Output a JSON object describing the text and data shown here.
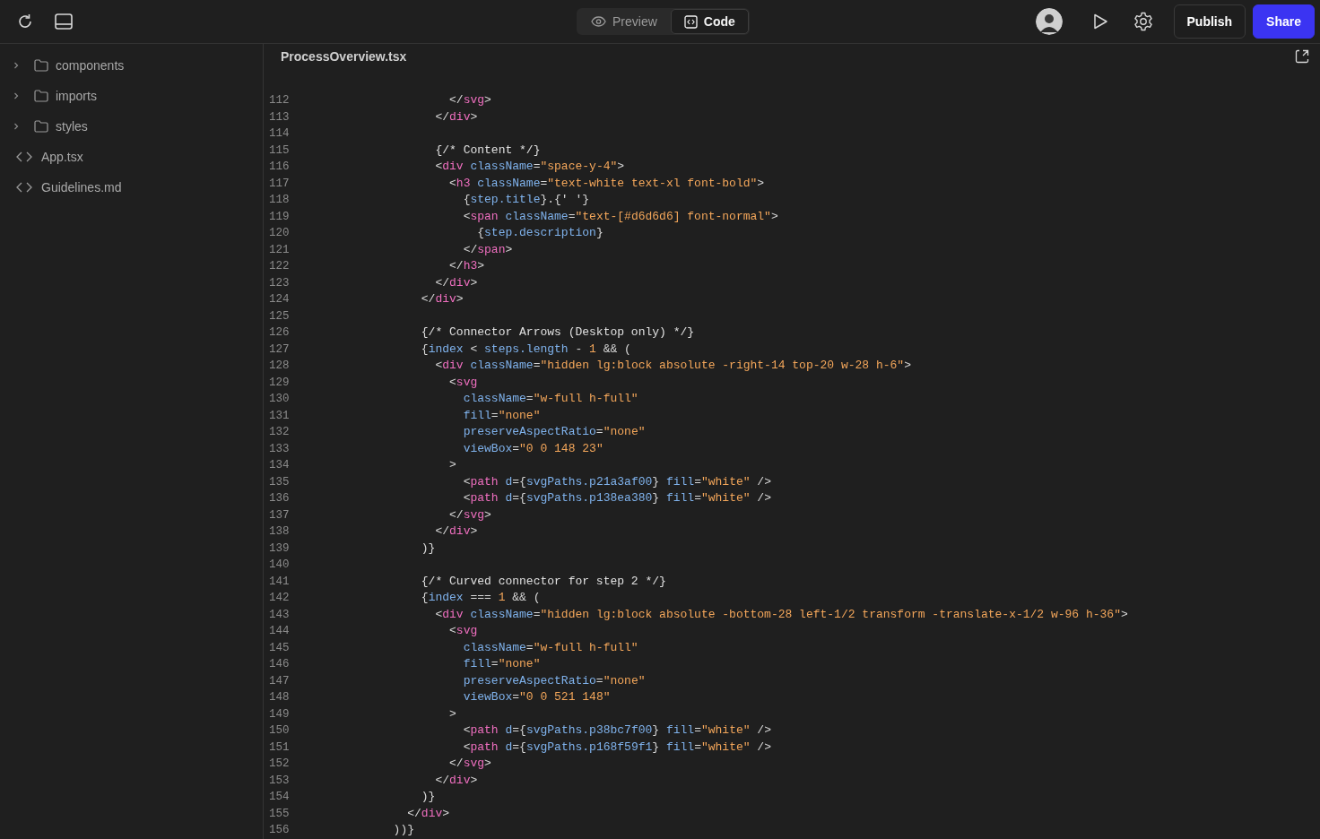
{
  "toolbar": {
    "view_tabs": [
      {
        "label": "Preview",
        "kind": "preview",
        "selected": false
      },
      {
        "label": "Code",
        "kind": "code",
        "selected": true
      }
    ],
    "buttons": [
      {
        "label": "Publish",
        "kind": "secondary"
      },
      {
        "label": "Share",
        "kind": "primary"
      }
    ]
  },
  "sidebar": {
    "items": [
      {
        "label": "components",
        "kind": "folder",
        "expanded": false
      },
      {
        "label": "imports",
        "kind": "folder",
        "expanded": false
      },
      {
        "label": "styles",
        "kind": "folder",
        "expanded": false
      },
      {
        "label": "App.tsx",
        "kind": "file"
      },
      {
        "label": "Guidelines.md",
        "kind": "file"
      }
    ]
  },
  "editor": {
    "file_tab": "ProcessOverview.tsx",
    "lines": [
      {
        "n": "112",
        "code": [
          {
            "text": "                    </",
            "kind": "punct"
          },
          {
            "text": "svg",
            "kind": "tag"
          },
          {
            "text": ">",
            "kind": "punct"
          }
        ]
      },
      {
        "n": "113",
        "code": [
          {
            "text": "                  </",
            "kind": "punct"
          },
          {
            "text": "div",
            "kind": "tag"
          },
          {
            "text": ">",
            "kind": "punct"
          }
        ]
      },
      {
        "n": "114"
      },
      {
        "n": "115",
        "code": [
          {
            "text": "                  {/* Content */}",
            "kind": "comment"
          }
        ]
      },
      {
        "n": "116",
        "code": [
          {
            "text": "                  <",
            "kind": "punct"
          },
          {
            "text": "div",
            "kind": "tag"
          },
          {
            "text": " className",
            "kind": "attr"
          },
          {
            "text": "=",
            "kind": "punct"
          },
          {
            "text": "\"space-y-4\"",
            "kind": "string"
          },
          {
            "text": ">",
            "kind": "punct"
          }
        ]
      },
      {
        "n": "117",
        "code": [
          {
            "text": "                    <",
            "kind": "punct"
          },
          {
            "text": "h3",
            "kind": "tag"
          },
          {
            "text": " className",
            "kind": "attr"
          },
          {
            "text": "=",
            "kind": "punct"
          },
          {
            "text": "\"text-white text-xl font-bold\"",
            "kind": "string"
          },
          {
            "text": ">",
            "kind": "punct"
          }
        ]
      },
      {
        "n": "118",
        "code": [
          {
            "text": "                      {",
            "kind": "punct"
          },
          {
            "text": "step.title",
            "kind": "variable"
          },
          {
            "text": "}.{' '}",
            "kind": "punct"
          }
        ]
      },
      {
        "n": "119",
        "code": [
          {
            "text": "                      <",
            "kind": "punct"
          },
          {
            "text": "span",
            "kind": "tag"
          },
          {
            "text": " className",
            "kind": "attr"
          },
          {
            "text": "=",
            "kind": "punct"
          },
          {
            "text": "\"text-[#d6d6d6] font-normal\"",
            "kind": "string"
          },
          {
            "text": ">",
            "kind": "punct"
          }
        ]
      },
      {
        "n": "120",
        "code": [
          {
            "text": "                        {",
            "kind": "punct"
          },
          {
            "text": "step.description",
            "kind": "variable"
          },
          {
            "text": "}",
            "kind": "punct"
          }
        ]
      },
      {
        "n": "121",
        "code": [
          {
            "text": "                      </",
            "kind": "punct"
          },
          {
            "text": "span",
            "kind": "tag"
          },
          {
            "text": ">",
            "kind": "punct"
          }
        ]
      },
      {
        "n": "122",
        "code": [
          {
            "text": "                    </",
            "kind": "punct"
          },
          {
            "text": "h3",
            "kind": "tag"
          },
          {
            "text": ">",
            "kind": "punct"
          }
        ]
      },
      {
        "n": "123",
        "code": [
          {
            "text": "                  </",
            "kind": "punct"
          },
          {
            "text": "div",
            "kind": "tag"
          },
          {
            "text": ">",
            "kind": "punct"
          }
        ]
      },
      {
        "n": "124",
        "code": [
          {
            "text": "                </",
            "kind": "punct"
          },
          {
            "text": "div",
            "kind": "tag"
          },
          {
            "text": ">",
            "kind": "punct"
          }
        ]
      },
      {
        "n": "125"
      },
      {
        "n": "126",
        "code": [
          {
            "text": "                {/* Connector Arrows (Desktop only) */}",
            "kind": "comment"
          }
        ]
      },
      {
        "n": "127",
        "code": [
          {
            "text": "                {",
            "kind": "punct"
          },
          {
            "text": "index",
            "kind": "variable"
          },
          {
            "text": " < ",
            "kind": "punct"
          },
          {
            "text": "steps.length",
            "kind": "variable"
          },
          {
            "text": " - ",
            "kind": "punct"
          },
          {
            "text": "1",
            "kind": "number"
          },
          {
            "text": " && (",
            "kind": "punct"
          }
        ]
      },
      {
        "n": "128",
        "code": [
          {
            "text": "                  <",
            "kind": "punct"
          },
          {
            "text": "div",
            "kind": "tag"
          },
          {
            "text": " className",
            "kind": "attr"
          },
          {
            "text": "=",
            "kind": "punct"
          },
          {
            "text": "\"hidden lg:block absolute -right-14 top-20 w-28 h-6\"",
            "kind": "string"
          },
          {
            "text": ">",
            "kind": "punct"
          }
        ]
      },
      {
        "n": "129",
        "code": [
          {
            "text": "                    <",
            "kind": "punct"
          },
          {
            "text": "svg",
            "kind": "tag"
          }
        ]
      },
      {
        "n": "130",
        "code": [
          {
            "text": "                      className",
            "kind": "attr"
          },
          {
            "text": "=",
            "kind": "punct"
          },
          {
            "text": "\"w-full h-full\"",
            "kind": "string"
          }
        ]
      },
      {
        "n": "131",
        "code": [
          {
            "text": "                      fill",
            "kind": "attr"
          },
          {
            "text": "=",
            "kind": "punct"
          },
          {
            "text": "\"none\"",
            "kind": "string"
          }
        ]
      },
      {
        "n": "132",
        "code": [
          {
            "text": "                      preserveAspectRatio",
            "kind": "attr"
          },
          {
            "text": "=",
            "kind": "punct"
          },
          {
            "text": "\"none\"",
            "kind": "string"
          }
        ]
      },
      {
        "n": "133",
        "code": [
          {
            "text": "                      viewBox",
            "kind": "attr"
          },
          {
            "text": "=",
            "kind": "punct"
          },
          {
            "text": "\"0 0 148 23\"",
            "kind": "string"
          }
        ]
      },
      {
        "n": "134",
        "code": [
          {
            "text": "                    >",
            "kind": "punct"
          }
        ]
      },
      {
        "n": "135",
        "code": [
          {
            "text": "                      <",
            "kind": "punct"
          },
          {
            "text": "path",
            "kind": "tag"
          },
          {
            "text": " d",
            "kind": "attr"
          },
          {
            "text": "={",
            "kind": "punct"
          },
          {
            "text": "svgPaths.p21a3af00",
            "kind": "variable"
          },
          {
            "text": "}",
            "kind": "punct"
          },
          {
            "text": " fill",
            "kind": "attr"
          },
          {
            "text": "=",
            "kind": "punct"
          },
          {
            "text": "\"white\"",
            "kind": "string"
          },
          {
            "text": " />",
            "kind": "punct"
          }
        ]
      },
      {
        "n": "136",
        "code": [
          {
            "text": "                      <",
            "kind": "punct"
          },
          {
            "text": "path",
            "kind": "tag"
          },
          {
            "text": " d",
            "kind": "attr"
          },
          {
            "text": "={",
            "kind": "punct"
          },
          {
            "text": "svgPaths.p138ea380",
            "kind": "variable"
          },
          {
            "text": "}",
            "kind": "punct"
          },
          {
            "text": " fill",
            "kind": "attr"
          },
          {
            "text": "=",
            "kind": "punct"
          },
          {
            "text": "\"white\"",
            "kind": "string"
          },
          {
            "text": " />",
            "kind": "punct"
          }
        ]
      },
      {
        "n": "137",
        "code": [
          {
            "text": "                    </",
            "kind": "punct"
          },
          {
            "text": "svg",
            "kind": "tag"
          },
          {
            "text": ">",
            "kind": "punct"
          }
        ]
      },
      {
        "n": "138",
        "code": [
          {
            "text": "                  </",
            "kind": "punct"
          },
          {
            "text": "div",
            "kind": "tag"
          },
          {
            "text": ">",
            "kind": "punct"
          }
        ]
      },
      {
        "n": "139",
        "code": [
          {
            "text": "                )}",
            "kind": "punct"
          }
        ]
      },
      {
        "n": "140"
      },
      {
        "n": "141",
        "code": [
          {
            "text": "                {/* Curved connector for step 2 */}",
            "kind": "comment"
          }
        ]
      },
      {
        "n": "142",
        "code": [
          {
            "text": "                {",
            "kind": "punct"
          },
          {
            "text": "index",
            "kind": "variable"
          },
          {
            "text": " === ",
            "kind": "punct"
          },
          {
            "text": "1",
            "kind": "number"
          },
          {
            "text": " && (",
            "kind": "punct"
          }
        ]
      },
      {
        "n": "143",
        "code": [
          {
            "text": "                  <",
            "kind": "punct"
          },
          {
            "text": "div",
            "kind": "tag"
          },
          {
            "text": " className",
            "kind": "attr"
          },
          {
            "text": "=",
            "kind": "punct"
          },
          {
            "text": "\"hidden lg:block absolute -bottom-28 left-1/2 transform -translate-x-1/2 w-96 h-36\"",
            "kind": "string"
          },
          {
            "text": ">",
            "kind": "punct"
          }
        ]
      },
      {
        "n": "144",
        "code": [
          {
            "text": "                    <",
            "kind": "punct"
          },
          {
            "text": "svg",
            "kind": "tag"
          }
        ]
      },
      {
        "n": "145",
        "code": [
          {
            "text": "                      className",
            "kind": "attr"
          },
          {
            "text": "=",
            "kind": "punct"
          },
          {
            "text": "\"w-full h-full\"",
            "kind": "string"
          }
        ]
      },
      {
        "n": "146",
        "code": [
          {
            "text": "                      fill",
            "kind": "attr"
          },
          {
            "text": "=",
            "kind": "punct"
          },
          {
            "text": "\"none\"",
            "kind": "string"
          }
        ]
      },
      {
        "n": "147",
        "code": [
          {
            "text": "                      preserveAspectRatio",
            "kind": "attr"
          },
          {
            "text": "=",
            "kind": "punct"
          },
          {
            "text": "\"none\"",
            "kind": "string"
          }
        ]
      },
      {
        "n": "148",
        "code": [
          {
            "text": "                      viewBox",
            "kind": "attr"
          },
          {
            "text": "=",
            "kind": "punct"
          },
          {
            "text": "\"0 0 521 148\"",
            "kind": "string"
          }
        ]
      },
      {
        "n": "149",
        "code": [
          {
            "text": "                    >",
            "kind": "punct"
          }
        ]
      },
      {
        "n": "150",
        "code": [
          {
            "text": "                      <",
            "kind": "punct"
          },
          {
            "text": "path",
            "kind": "tag"
          },
          {
            "text": " d",
            "kind": "attr"
          },
          {
            "text": "={",
            "kind": "punct"
          },
          {
            "text": "svgPaths.p38bc7f00",
            "kind": "variable"
          },
          {
            "text": "}",
            "kind": "punct"
          },
          {
            "text": " fill",
            "kind": "attr"
          },
          {
            "text": "=",
            "kind": "punct"
          },
          {
            "text": "\"white\"",
            "kind": "string"
          },
          {
            "text": " />",
            "kind": "punct"
          }
        ]
      },
      {
        "n": "151",
        "code": [
          {
            "text": "                      <",
            "kind": "punct"
          },
          {
            "text": "path",
            "kind": "tag"
          },
          {
            "text": " d",
            "kind": "attr"
          },
          {
            "text": "={",
            "kind": "punct"
          },
          {
            "text": "svgPaths.p168f59f1",
            "kind": "variable"
          },
          {
            "text": "}",
            "kind": "punct"
          },
          {
            "text": " fill",
            "kind": "attr"
          },
          {
            "text": "=",
            "kind": "punct"
          },
          {
            "text": "\"white\"",
            "kind": "string"
          },
          {
            "text": " />",
            "kind": "punct"
          }
        ]
      },
      {
        "n": "152",
        "code": [
          {
            "text": "                    </",
            "kind": "punct"
          },
          {
            "text": "svg",
            "kind": "tag"
          },
          {
            "text": ">",
            "kind": "punct"
          }
        ]
      },
      {
        "n": "153",
        "code": [
          {
            "text": "                  </",
            "kind": "punct"
          },
          {
            "text": "div",
            "kind": "tag"
          },
          {
            "text": ">",
            "kind": "punct"
          }
        ]
      },
      {
        "n": "154",
        "code": [
          {
            "text": "                )}",
            "kind": "punct"
          }
        ]
      },
      {
        "n": "155",
        "code": [
          {
            "text": "              </",
            "kind": "punct"
          },
          {
            "text": "div",
            "kind": "tag"
          },
          {
            "text": ">",
            "kind": "punct"
          }
        ]
      },
      {
        "n": "156",
        "code": [
          {
            "text": "            ))}",
            "kind": "punct"
          }
        ]
      }
    ]
  }
}
